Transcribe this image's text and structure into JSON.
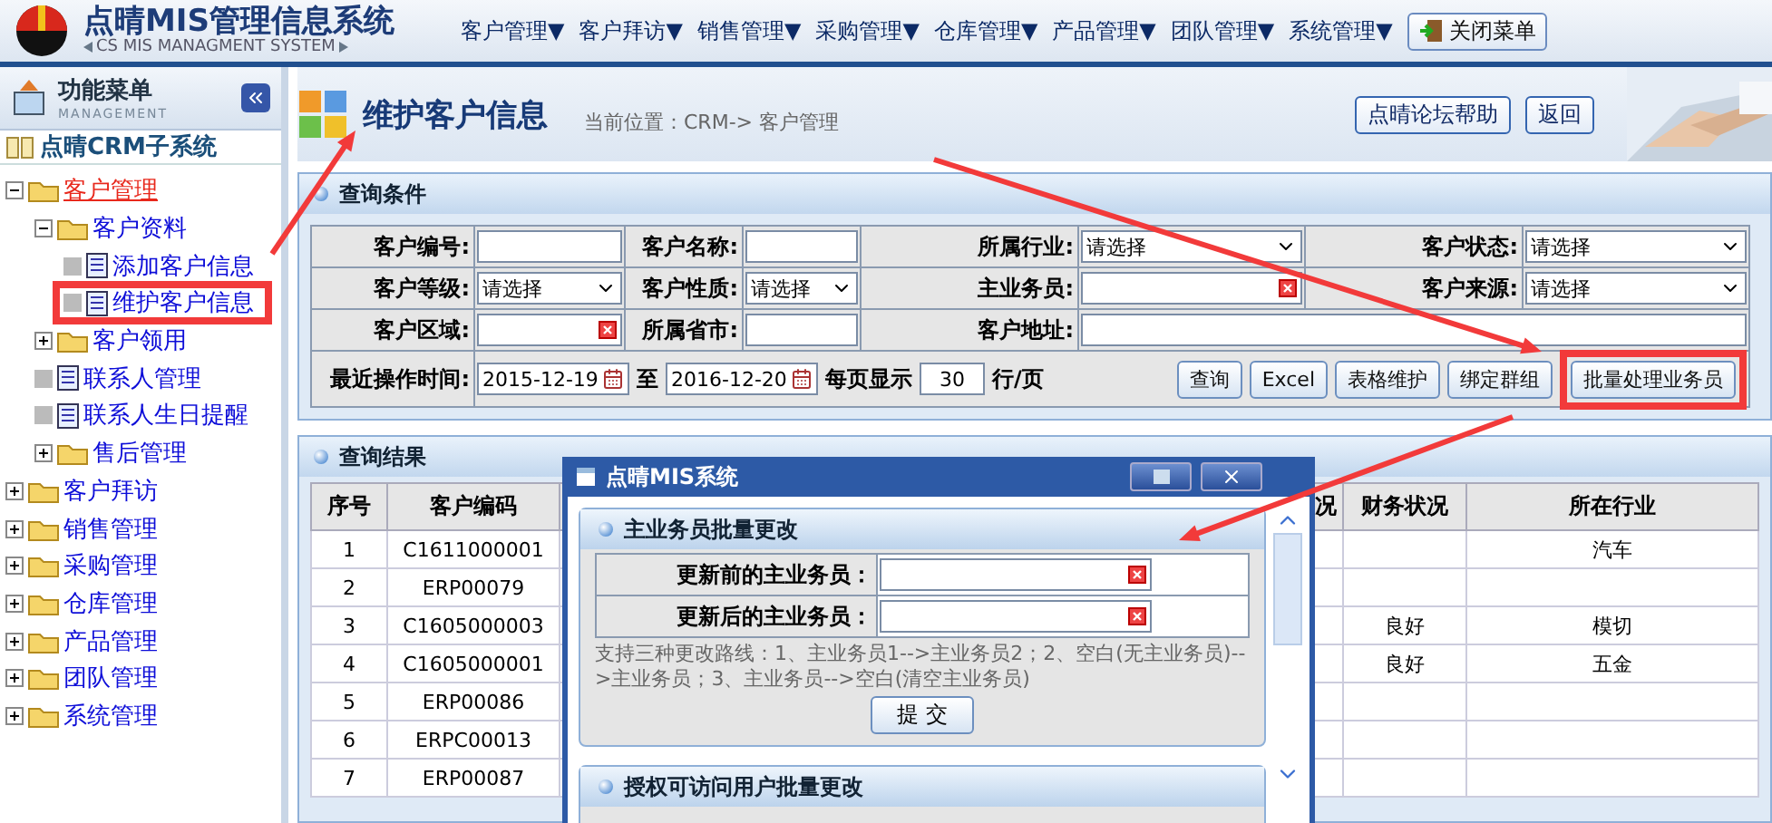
{
  "header": {
    "title": "点晴MIS管理信息系统",
    "subtitle": "CS MIS MANAGMENT SYSTEM",
    "menu": [
      "客户管理▼",
      "客户拜访▼",
      "销售管理▼",
      "采购管理▼",
      "仓库管理▼",
      "产品管理▼",
      "团队管理▼",
      "系统管理▼"
    ],
    "close_menu": "关闭菜单"
  },
  "sidebar": {
    "title": "功能菜单",
    "subtitle": "MANAGEMENT",
    "system": "点晴CRM子系统",
    "tree": [
      {
        "label": "客户管理",
        "kind": "folder",
        "expanded": true,
        "selected": true,
        "children": [
          {
            "label": "客户资料",
            "kind": "folder",
            "expanded": true,
            "selected": false,
            "children": [
              {
                "label": "添加客户信息",
                "kind": "page",
                "selected": false
              },
              {
                "label": "维护客户信息",
                "kind": "page",
                "selected": false,
                "highlighted": true
              }
            ]
          },
          {
            "label": "客户领用",
            "kind": "folder",
            "expanded": false,
            "selected": false
          },
          {
            "label": "联系人管理",
            "kind": "page",
            "selected": false
          },
          {
            "label": "联系人生日提醒",
            "kind": "page",
            "selected": false
          },
          {
            "label": "售后管理",
            "kind": "folder",
            "expanded": false,
            "selected": false
          }
        ]
      },
      {
        "label": "客户拜访",
        "kind": "folder",
        "expanded": false,
        "selected": false
      },
      {
        "label": "销售管理",
        "kind": "folder",
        "expanded": false,
        "selected": false
      },
      {
        "label": "采购管理",
        "kind": "folder",
        "expanded": false,
        "selected": false
      },
      {
        "label": "仓库管理",
        "kind": "folder",
        "expanded": false,
        "selected": false
      },
      {
        "label": "产品管理",
        "kind": "folder",
        "expanded": false,
        "selected": false
      },
      {
        "label": "团队管理",
        "kind": "folder",
        "expanded": false,
        "selected": false
      },
      {
        "label": "系统管理",
        "kind": "folder",
        "expanded": false,
        "selected": false
      }
    ]
  },
  "page": {
    "title": "维护客户信息",
    "breadcrumb": "当前位置：CRM-> 客户管理",
    "buttons": [
      "点晴论坛帮助",
      "返回"
    ]
  },
  "query": {
    "title": "查询条件",
    "rows": [
      [
        {
          "label": "客户编号:",
          "kind": "text"
        },
        {
          "label": "客户名称:",
          "kind": "text"
        },
        {
          "label": "所属行业:",
          "kind": "select",
          "value": "请选择"
        },
        {
          "label": "客户状态:",
          "kind": "select",
          "value": "请选择"
        }
      ],
      [
        {
          "label": "客户等级:",
          "kind": "select",
          "value": "请选择"
        },
        {
          "label": "客户性质:",
          "kind": "select",
          "value": "请选择"
        },
        {
          "label": "主业务员:",
          "kind": "lookup"
        },
        {
          "label": "客户来源:",
          "kind": "select",
          "value": "请选择"
        }
      ],
      [
        {
          "label": "客户区域:",
          "kind": "lookup"
        },
        {
          "label": "所属省市:",
          "kind": "text"
        },
        {
          "label": "客户地址:",
          "kind": "text"
        }
      ]
    ],
    "time_label": "最近操作时间:",
    "date_from": "2015-12-19",
    "date_sep": "至",
    "date_to": "2016-12-20",
    "page_size_label": "每页显示",
    "page_size": "30",
    "page_size_unit": "行/页",
    "buttons": [
      {
        "label": "查询",
        "highlighted": false
      },
      {
        "label": "Excel",
        "highlighted": false
      },
      {
        "label": "表格维护",
        "highlighted": false
      },
      {
        "label": "绑定群组",
        "highlighted": false
      },
      {
        "label": "批量处理业务员",
        "highlighted": true
      }
    ]
  },
  "results": {
    "title": "查询结果",
    "columns": [
      {
        "label": "序号",
        "kind": "narrow"
      },
      {
        "label": "客户编码",
        "kind": "code"
      },
      {
        "label": "况",
        "kind": "cut"
      },
      {
        "label": "财务状况",
        "kind": "mid"
      },
      {
        "label": "所在行业",
        "kind": "wide"
      }
    ],
    "rows": [
      {
        "no": "1",
        "code": "C1611000001",
        "industry": "汽车"
      },
      {
        "no": "2",
        "code": "ERP00079"
      },
      {
        "no": "3",
        "code": "C1605000003",
        "finance": "良好",
        "industry": "模切"
      },
      {
        "no": "4",
        "code": "C1605000001",
        "finance": "良好",
        "industry": "五金"
      },
      {
        "no": "5",
        "code": "ERP00086"
      },
      {
        "no": "6",
        "code": "ERPC00013"
      },
      {
        "no": "7",
        "code": "ERP00087"
      }
    ]
  },
  "dialog": {
    "title": "点晴MIS系统",
    "sections": [
      {
        "title": "主业务员批量更改",
        "fields": [
          "更新前的主业务员：",
          "更新后的主业务员："
        ],
        "note": "支持三种更改路线：1、主业务员1-->主业务员2；2、空白(无主业务员)-->主业务员；3、主业务员-->空白(清空主业务员)",
        "submit": "提 交"
      },
      {
        "title": "授权可访问用户批量更改"
      }
    ]
  }
}
